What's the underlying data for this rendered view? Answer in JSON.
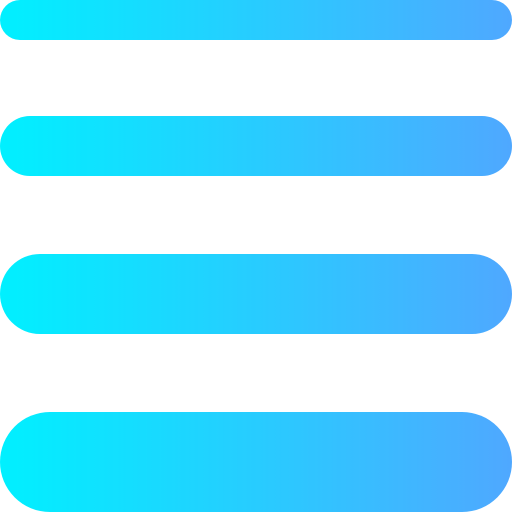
{
  "icon": {
    "name": "menu-lines-icon",
    "gradient_start": "#00F0FF",
    "gradient_end": "#4FA8FF"
  }
}
